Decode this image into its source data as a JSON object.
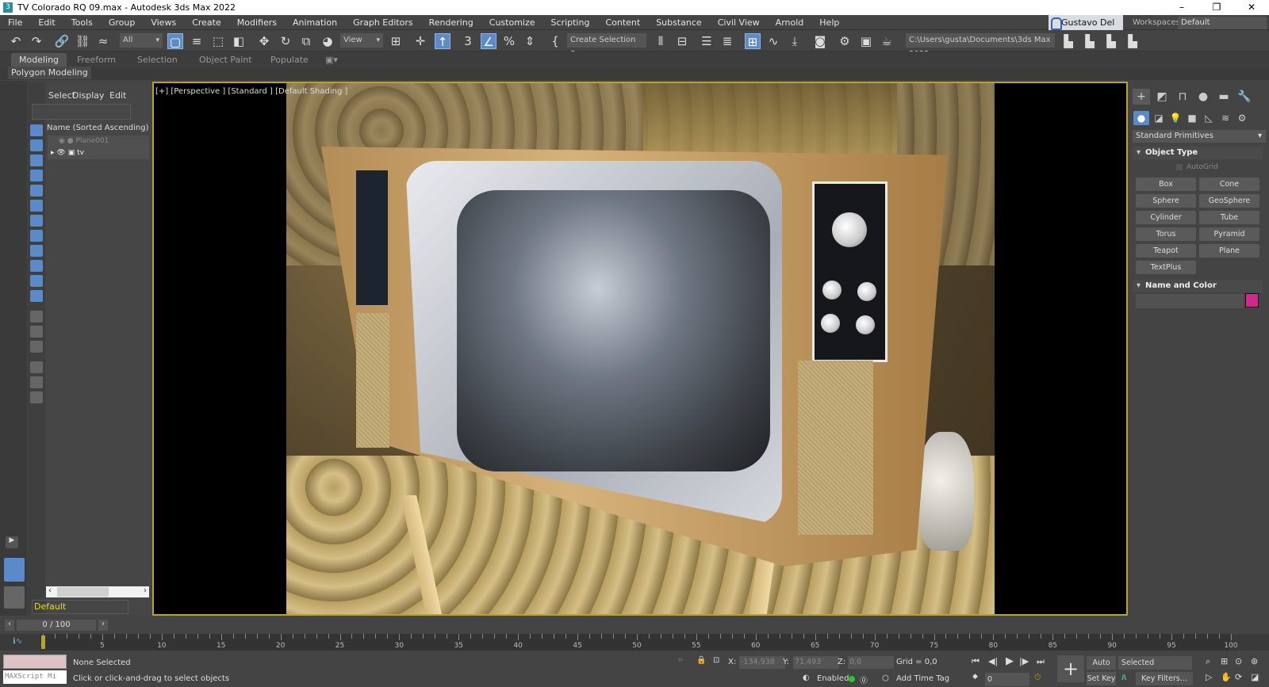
{
  "window": {
    "title": "TV Colorado RQ 09.max - Autodesk 3ds Max 2022",
    "app_icon": "3",
    "minimize": "–",
    "restore": "❐",
    "close": "✕"
  },
  "menu": [
    "File",
    "Edit",
    "Tools",
    "Group",
    "Views",
    "Create",
    "Modifiers",
    "Animation",
    "Graph Editors",
    "Rendering",
    "Customize",
    "Scripting",
    "Content",
    "Substance",
    "Civil View",
    "Arnold",
    "Help"
  ],
  "user": {
    "name": "Gustavo Del V...▾"
  },
  "workspaces": {
    "label": "Workspaces:",
    "value": "Default"
  },
  "toolbar": {
    "filter": "All",
    "ref_coord": "View",
    "named_selection": "Create Selection Se",
    "project_path": "C:\\Users\\gusta\\Documents\\3ds Max 2022"
  },
  "ribbon": {
    "tabs": [
      "Modeling",
      "Freeform",
      "Selection",
      "Object Paint",
      "Populate"
    ],
    "active": "Modeling",
    "sub": "Polygon Modeling"
  },
  "explorer": {
    "menu": [
      "Select",
      "Display",
      "Edit"
    ],
    "column": "Name (Sorted Ascending)",
    "items": [
      {
        "name": "Plane001",
        "hidden": true
      },
      {
        "name": "tv",
        "hidden": false
      }
    ],
    "layer": "Default"
  },
  "viewport": {
    "label": "[+] [Perspective ] [Standard ] [Default Shading ]"
  },
  "command_panel": {
    "category": "Standard Primitives",
    "object_type": "Object Type",
    "autogrid": "AutoGrid",
    "buttons": [
      "Box",
      "Cone",
      "Sphere",
      "GeoSphere",
      "Cylinder",
      "Tube",
      "Torus",
      "Pyramid",
      "Teapot",
      "Plane",
      "TextPlus"
    ],
    "name_and_color": "Name and Color",
    "color": "#d1288b"
  },
  "timeline": {
    "frame": "0 / 100",
    "ticks": [
      0,
      5,
      10,
      15,
      20,
      25,
      30,
      35,
      40,
      45,
      50,
      55,
      60,
      65,
      70,
      75,
      80,
      85,
      90,
      95,
      100
    ],
    "current": 0
  },
  "status": {
    "maxscript": "MAXScript Mi",
    "selection": "None Selected",
    "prompt": "Click or click-and-drag to select objects",
    "x_label": "X:",
    "x": "-134,938",
    "y_label": "Y:",
    "y": "71,493",
    "z_label": "Z:",
    "z": "0,0",
    "grid": "Grid = 0,0",
    "enabled": "Enabled:",
    "add_time_tag": "Add Time Tag",
    "auto_key": "Auto Key",
    "set_key": "Set Key",
    "key_mode": "Selected",
    "key_filters": "Key Filters...",
    "frame_field": "0"
  }
}
